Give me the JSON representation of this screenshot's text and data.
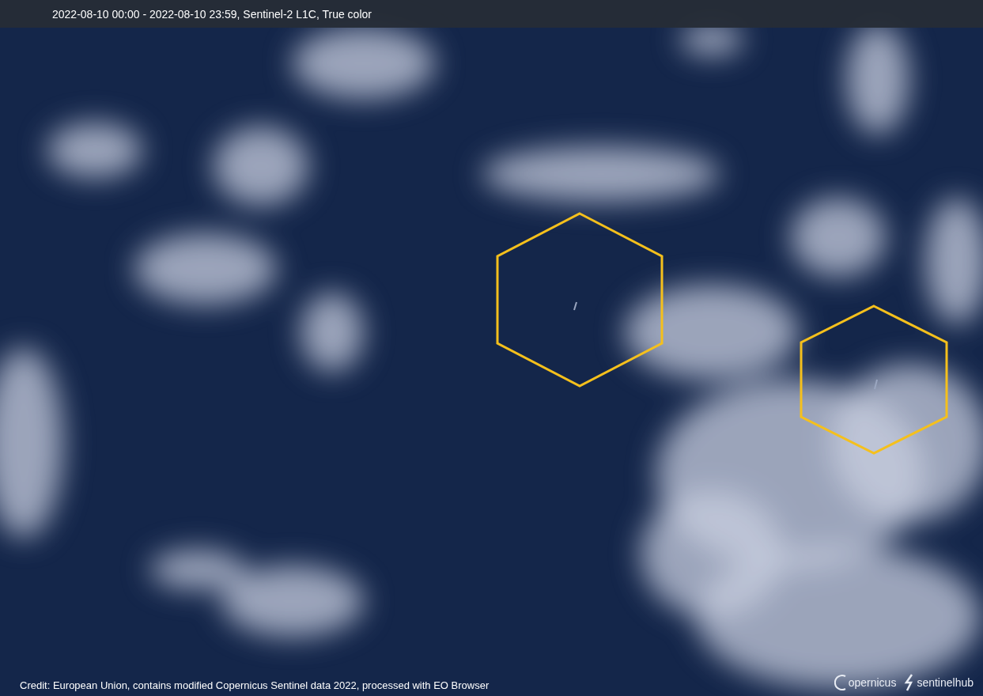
{
  "header": {
    "title": "2022-08-10 00:00 - 2022-08-10 23:59, Sentinel-2 L1C, True color"
  },
  "credit": "Credit: European Union, contains modified Copernicus Sentinel data 2022, processed with EO Browser",
  "logos": [
    {
      "kind": "copernicus",
      "text": "opernicus"
    },
    {
      "kind": "sentinelhub",
      "text": "sentinelhub"
    }
  ]
}
